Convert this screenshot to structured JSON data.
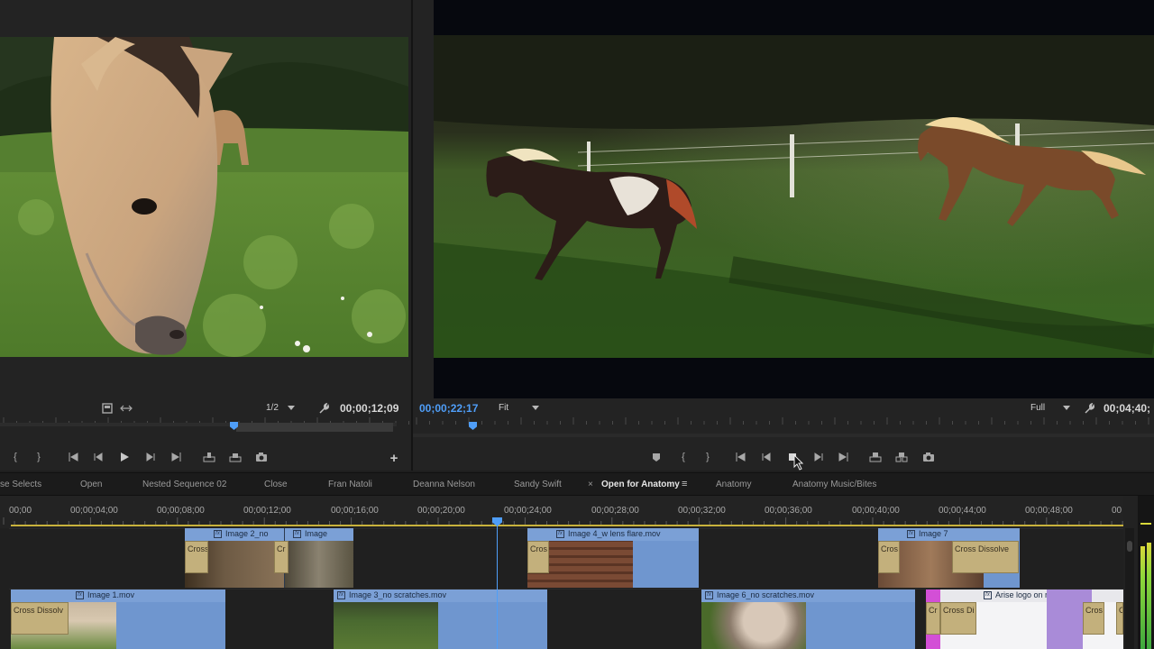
{
  "source": {
    "zoom": "1/2",
    "timecode": "00;00;12;09"
  },
  "program": {
    "timecode_current": "00;00;22;17",
    "zoom": "Fit",
    "resolution": "Full",
    "timecode_duration": "00;04;40;"
  },
  "tabs": [
    {
      "label": "se Selects"
    },
    {
      "label": "Open"
    },
    {
      "label": "Nested Sequence 02"
    },
    {
      "label": "Close"
    },
    {
      "label": "Fran Natoli"
    },
    {
      "label": "Deanna Nelson"
    },
    {
      "label": "Sandy Swift"
    },
    {
      "label": "Open for Anatomy",
      "active": true
    },
    {
      "label": "Anatomy"
    },
    {
      "label": "Anatomy Music/Bites"
    }
  ],
  "tab_close_glyph": "×",
  "tab_menu_glyph": "≡",
  "ruler": [
    "00;00",
    "00;00;04;00",
    "00;00;08;00",
    "00;00;12;00",
    "00;00;16;00",
    "00;00;20;00",
    "00;00;24;00",
    "00;00;28;00",
    "00;00;32;00",
    "00;00;36;00",
    "00;00;40;00",
    "00;00;44;00",
    "00;00;48;00",
    "00"
  ],
  "clips": {
    "v2_a": "Image 2_no",
    "v2_b": "Image",
    "v2_c": "Image 4_w lens flare.mov",
    "v2_d": "Image 7",
    "v1_a": "Image 1.mov",
    "v1_b": "Image 3_no scratches.mov",
    "v1_c": "Image 6_no scratches.mov",
    "v1_d": "Arise logo on rainbow"
  },
  "transitions": {
    "t1": "Cross",
    "t2": "Cr",
    "t3": "Cros",
    "t4": "Cros",
    "t5": "Cross Dissolve",
    "t6": "Cross Dissolv",
    "t7": "Cr",
    "t8": "Cross Di",
    "t9": "Cros",
    "t10": "Cr"
  },
  "fx_glyph": "fx",
  "colors": {
    "accent_blue": "#4f9ef8",
    "clip_blue": "#7ba0d6",
    "transition_tan": "#c3b07c",
    "clip_purple": "#a98bd8",
    "clip_magenta": "#d34fd6",
    "workarea_yellow": "#c8b23c"
  }
}
